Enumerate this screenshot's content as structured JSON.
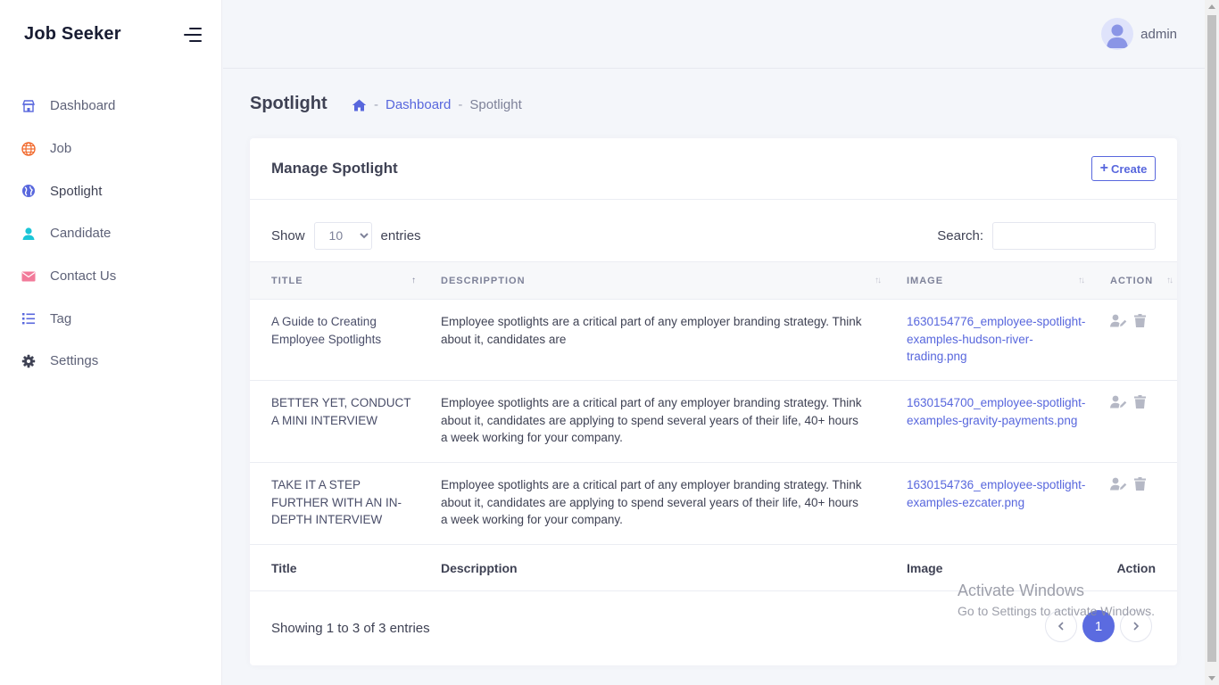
{
  "app": {
    "brand": "Job Seeker"
  },
  "sidebar": {
    "items": [
      {
        "label": "Dashboard",
        "icon": "store-icon",
        "color": "#5867dd"
      },
      {
        "label": "Job",
        "icon": "globe-icon",
        "color": "#f1692c"
      },
      {
        "label": "Spotlight",
        "icon": "globe-alt-icon",
        "color": "#5867dd",
        "active": true
      },
      {
        "label": "Candidate",
        "icon": "user-icon",
        "color": "#1bc5d7"
      },
      {
        "label": "Contact Us",
        "icon": "mail-icon",
        "color": "#f27a9a"
      },
      {
        "label": "Tag",
        "icon": "list-icon",
        "color": "#5867dd"
      },
      {
        "label": "Settings",
        "icon": "gear-icon",
        "color": "#3f4254"
      }
    ]
  },
  "topbar": {
    "user_name": "admin"
  },
  "page": {
    "title": "Spotlight",
    "breadcrumb": {
      "home_icon": "home-icon",
      "link": "Dashboard",
      "current": "Spotlight",
      "separator": "-"
    }
  },
  "card": {
    "title": "Manage Spotlight",
    "create_label": "Create",
    "show_label": "Show",
    "entries_label": "entries",
    "page_size": "10",
    "search_label": "Search:",
    "search_value": "",
    "columns": [
      "TITLE",
      "DESCRIPPTION",
      "IMAGE",
      "ACTION"
    ],
    "rows": [
      {
        "title": "A Guide to Creating Employee Spotlights",
        "description": "Employee spotlights are a critical part of any employer branding strategy. Think about it, candidates are",
        "image": "1630154776_employee-spotlight-examples-hudson-river-trading.png"
      },
      {
        "title": "BETTER YET, CONDUCT A MINI INTERVIEW",
        "description": "Employee spotlights are a critical part of any employer branding strategy. Think about it, candidates are applying to spend several years of their life, 40+ hours a week working for your company.",
        "image": "1630154700_employee-spotlight-examples-gravity-payments.png"
      },
      {
        "title": "TAKE IT A STEP FURTHER WITH AN IN-DEPTH INTERVIEW",
        "description": "Employee spotlights are a critical part of any employer branding strategy. Think about it, candidates are applying to spend several years of their life, 40+ hours a week working for your company.",
        "image": "1630154736_employee-spotlight-examples-ezcater.png"
      }
    ],
    "footer_columns": [
      "Title",
      "Descripption",
      "Image",
      "Action"
    ],
    "info": "Showing 1 to 3 of 3 entries",
    "current_page": "1"
  },
  "watermark": {
    "line1": "Activate Windows",
    "line2": "Go to Settings to activate Windows."
  },
  "colors": {
    "accent": "#5867dd"
  }
}
